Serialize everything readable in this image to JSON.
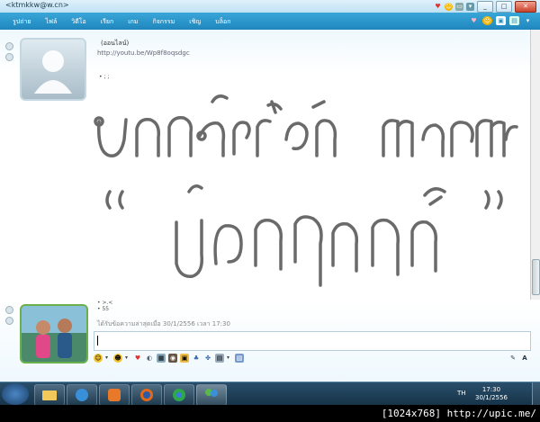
{
  "window": {
    "title": "<ktmkkw@w.cn>"
  },
  "menu": {
    "items": [
      "รูปถ่าย",
      "ไฟล์",
      "วิดีโอ",
      "เรียก",
      "เกม",
      "กิจกรรม",
      "เชิญ",
      "บล็อก"
    ]
  },
  "contact": {
    "display_name": "(ออนไลน์)",
    "personal_message": "http://youtu.be/Wp8f8oqsdgc"
  },
  "conversation": {
    "dots": "• ; ;",
    "handwriting_line1": "บอกได้แค่รัก มากมาย",
    "handwriting_line2": "“ น้องปอนด์ ”"
  },
  "self": {
    "msg1": "• >.<",
    "msg2": "• 55",
    "last_message": "ได้รับข้อความล่าสุดเมื่อ 30/1/2556 เวลา 17:30"
  },
  "taskbar": {
    "language": "TH",
    "time": "17:30",
    "date": "30/1/2556"
  },
  "watermark": "[1024x768] http://upic.me/",
  "colors": {
    "menu_bar": "#2a93c9",
    "title_bar": "#cfe8f5",
    "taskbar": "#1f3f57"
  }
}
